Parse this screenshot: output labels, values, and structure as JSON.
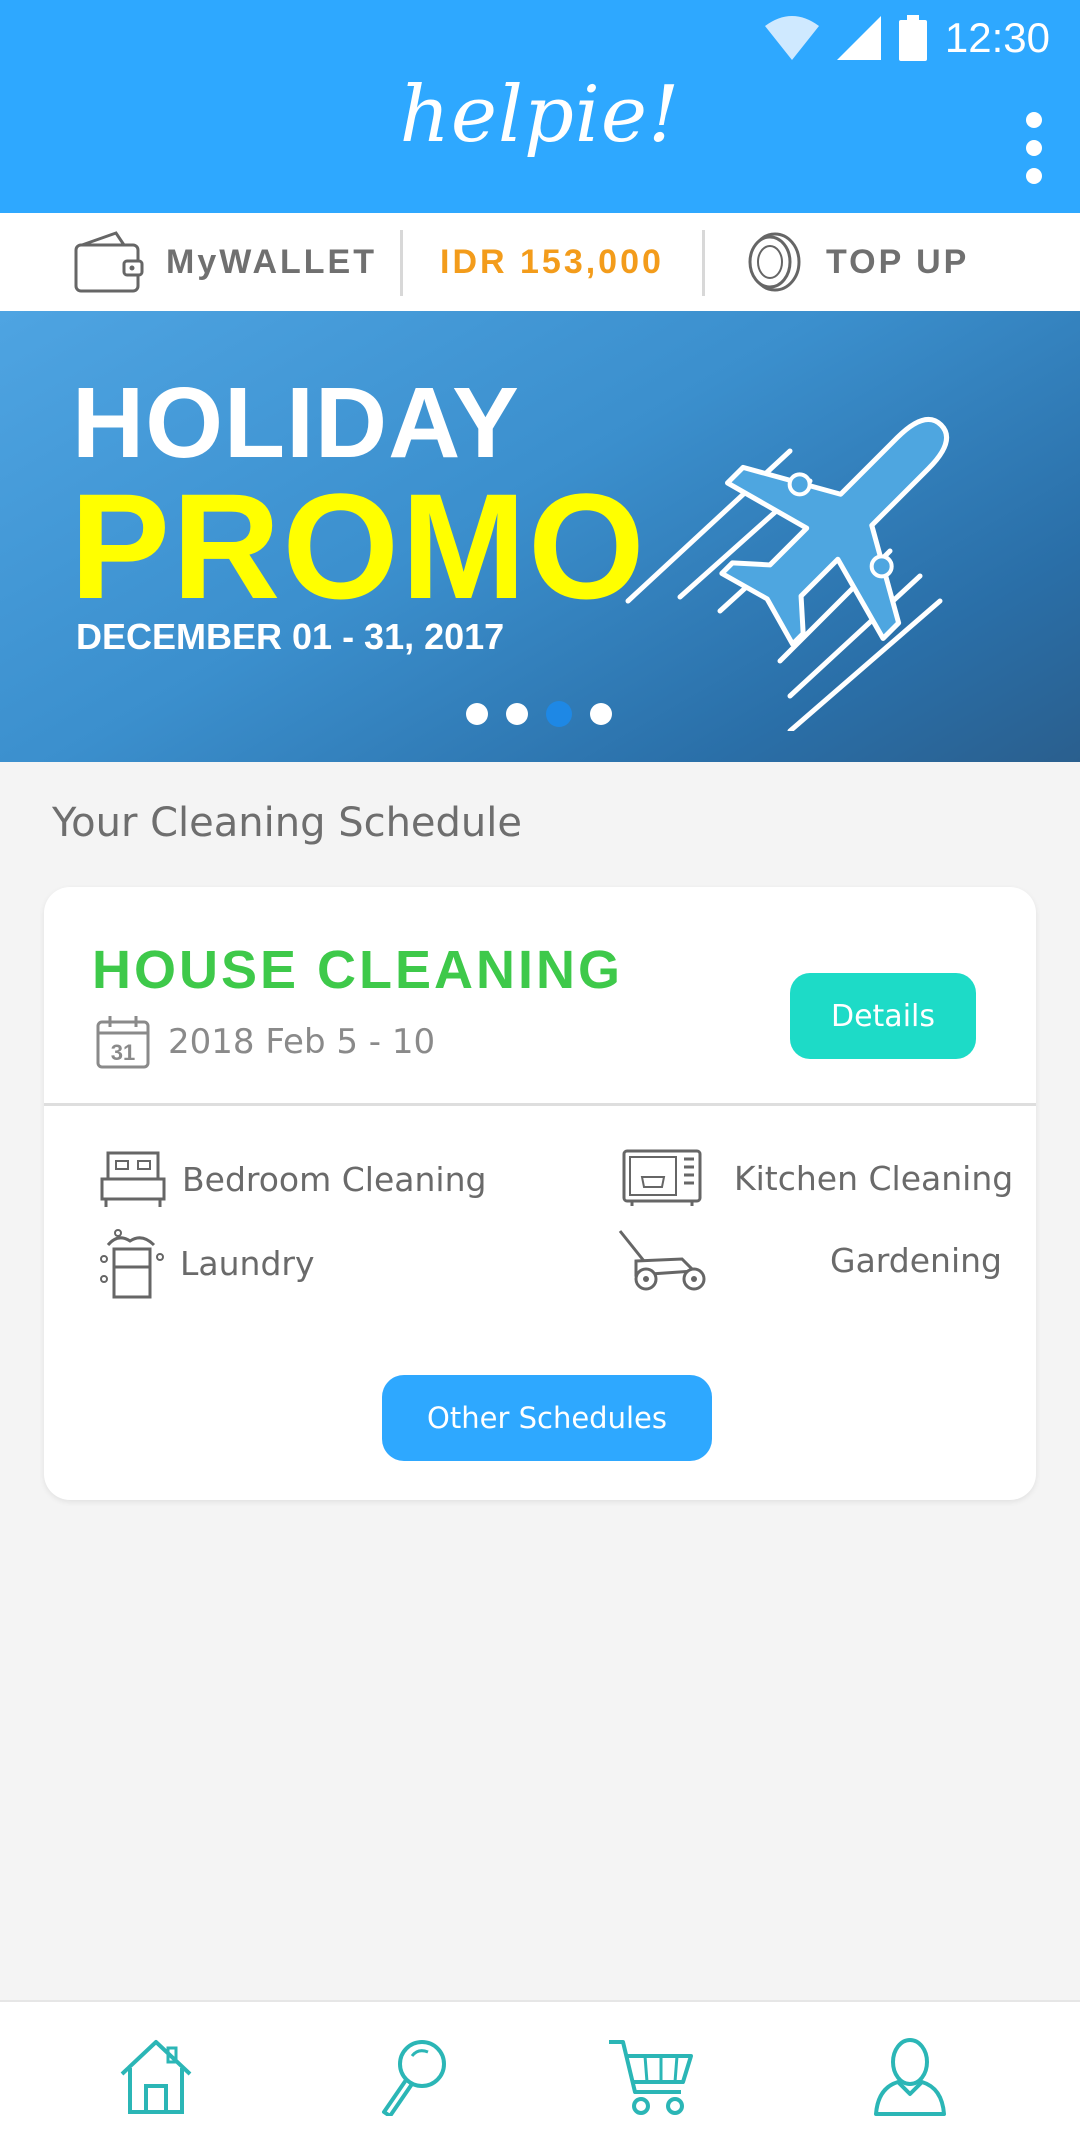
{
  "status_bar": {
    "time": "12:30"
  },
  "header": {
    "logo": "helpie!"
  },
  "wallet_bar": {
    "wallet_label": "MyWALLET",
    "balance": "IDR 153,000",
    "topup_label": "TOP UP"
  },
  "banner": {
    "line1": "HOLIDAY",
    "line2": "PROMO",
    "dates": "DECEMBER 01 - 31, 2017",
    "slides": 4,
    "active_slide": 3
  },
  "schedule": {
    "section_title": "Your Cleaning Schedule",
    "card": {
      "title": "HOUSE CLEANING",
      "date_range": "2018 Feb 5 - 10",
      "calendar_day": "31",
      "details_label": "Details",
      "services": [
        "Bedroom Cleaning",
        "Kitchen Cleaning",
        "Laundry",
        "Gardening"
      ],
      "other_label": "Other Schedules"
    }
  },
  "bottom_nav": {
    "items": [
      "home-icon",
      "search-icon",
      "cart-icon",
      "profile-icon"
    ]
  },
  "colors": {
    "primary": "#2ea8ff",
    "accent_teal": "#1ddbc7",
    "title_green": "#3ec94a",
    "balance_orange": "#f39c1b",
    "promo_yellow": "#ffff00",
    "nav_icon": "#2bb6b6"
  }
}
